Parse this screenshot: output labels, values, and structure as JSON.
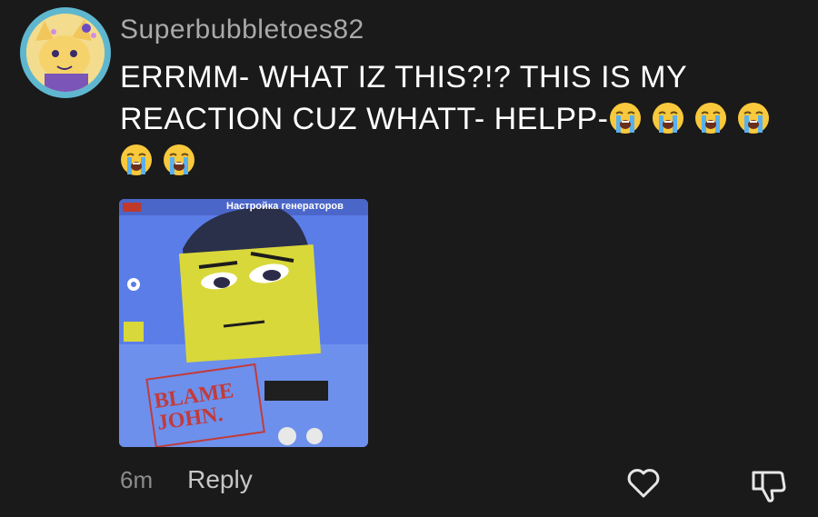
{
  "comment": {
    "username": "Superbubbletoes82",
    "text": "ERRMM- WHAT IZ THIS?!? THIS IS MY REACTION CUZ WHATT- HELPP-",
    "emoji": "loudly-crying-face",
    "emoji_count": 6,
    "attachment": {
      "title_text": "Настройка генераторов",
      "stamp_text": "BLAME\nJOHN."
    },
    "timestamp": "6m",
    "reply_label": "Reply",
    "like_icon": "heart-outline-icon",
    "dislike_icon": "thumbs-down-outline-icon"
  },
  "colors": {
    "background": "#1a1a1a",
    "username": "#a9a9a9",
    "text": "#ffffff",
    "avatar_ring": "#5fb7cf"
  }
}
